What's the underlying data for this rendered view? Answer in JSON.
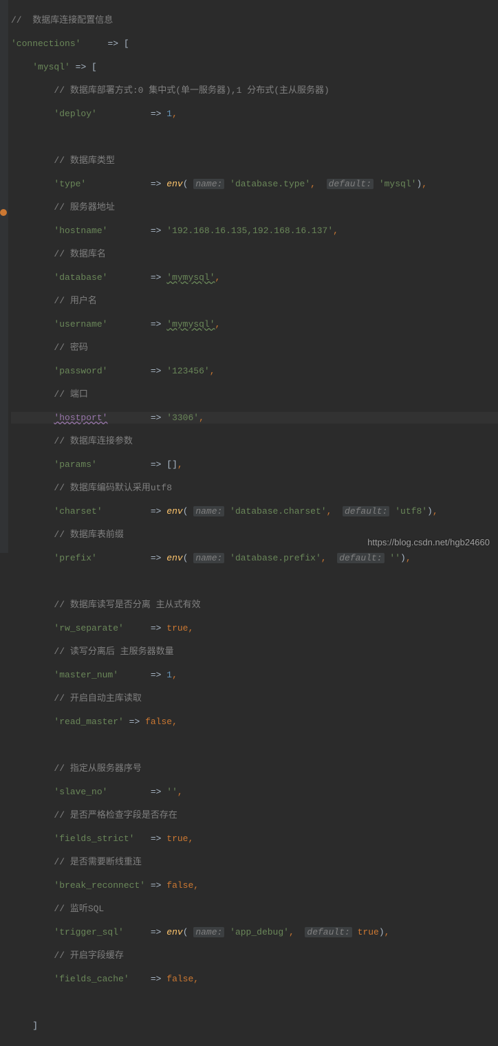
{
  "comments": {
    "c0": "//  数据库连接配置信息",
    "c1": "// 数据库部署方式:0 集中式(单一服务器),1 分布式(主从服务器)",
    "c2": "// 数据库类型",
    "c3": "// 服务器地址",
    "c4": "// 数据库名",
    "c5": "// 用户名",
    "c6": "// 密码",
    "c7": "// 端口",
    "c8": "// 数据库连接参数",
    "c9": "// 数据库编码默认采用utf8",
    "c10": "// 数据库表前缀",
    "c11": "// 数据库读写是否分离 主从式有效",
    "c12": "// 读写分离后 主服务器数量",
    "c13": "// 开启自动主库读取",
    "c14": "// 指定从服务器序号",
    "c15": "// 是否严格检查字段是否存在",
    "c16": "// 是否需要断线重连",
    "c17": "// 监听SQL",
    "c18": "// 开启字段缓存"
  },
  "keys": {
    "connections": "'connections'",
    "mysql": "'mysql'",
    "deploy": "'deploy'",
    "type": "'type'",
    "hostname": "'hostname'",
    "database": "'database'",
    "username": "'username'",
    "password": "'password'",
    "hostport": "'hostport'",
    "params": "'params'",
    "charset": "'charset'",
    "prefix": "'prefix'",
    "rw_separate": "'rw_separate'",
    "master_num": "'master_num'",
    "read_master": "'read_master'",
    "slave_no": "'slave_no'",
    "fields_strict": "'fields_strict'",
    "break_reconnect": "'break_reconnect'",
    "trigger_sql": "'trigger_sql'",
    "fields_cache": "'fields_cache'"
  },
  "vals": {
    "deploy": "1",
    "hostname": "'192.168.16.135,192.168.16.137'",
    "database_v": "'mymysql'",
    "username_v": "'mymysql'",
    "password": "'123456'",
    "hostport": "'3306'",
    "params": "[]",
    "master_num": "1",
    "slave_no": "''",
    "env_dbtype": "'database.type'",
    "env_dbtype_def": "'mysql'",
    "env_charset": "'database.charset'",
    "env_charset_def": "'utf8'",
    "env_prefix": "'database.prefix'",
    "env_prefix_def": "''",
    "env_appdebug": "'app_debug'",
    "name_label": "name:",
    "default_label": "default:",
    "env": "env",
    "true": "true",
    "false": "false",
    "arrow": "=>",
    "arrow_open": "=> [",
    "comma": ",",
    "open_paren": "(",
    "close_paren": ")",
    "close_bracket": "]"
  },
  "watermark": "https://blog.csdn.net/hgb24660"
}
